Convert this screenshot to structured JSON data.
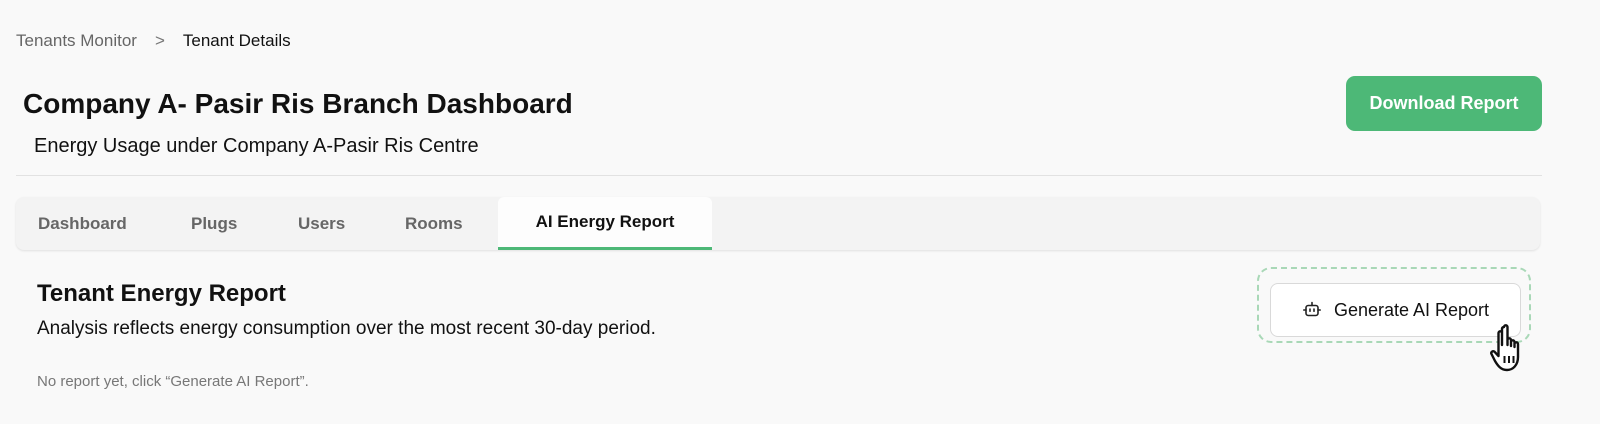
{
  "breadcrumb": {
    "parent": "Tenants Monitor",
    "separator": ">",
    "current": "Tenant Details"
  },
  "header": {
    "title": "Company A- Pasir Ris Branch Dashboard",
    "subtitle": "Energy Usage under Company A-Pasir Ris Centre",
    "download_label": "Download Report"
  },
  "tabs": [
    {
      "label": "Dashboard",
      "active": false
    },
    {
      "label": "Plugs",
      "active": false
    },
    {
      "label": "Users",
      "active": false
    },
    {
      "label": "Rooms",
      "active": false
    },
    {
      "label": "AI Energy Report",
      "active": true
    }
  ],
  "report": {
    "title": "Tenant Energy Report",
    "description": "Analysis reflects energy consumption over the most recent 30-day period.",
    "empty_note": "No report yet, click “Generate AI Report”.",
    "generate_label": "Generate AI Report",
    "generate_icon": "robot-icon"
  },
  "colors": {
    "accent": "#4db877",
    "highlight_border": "#a9d8b7"
  }
}
